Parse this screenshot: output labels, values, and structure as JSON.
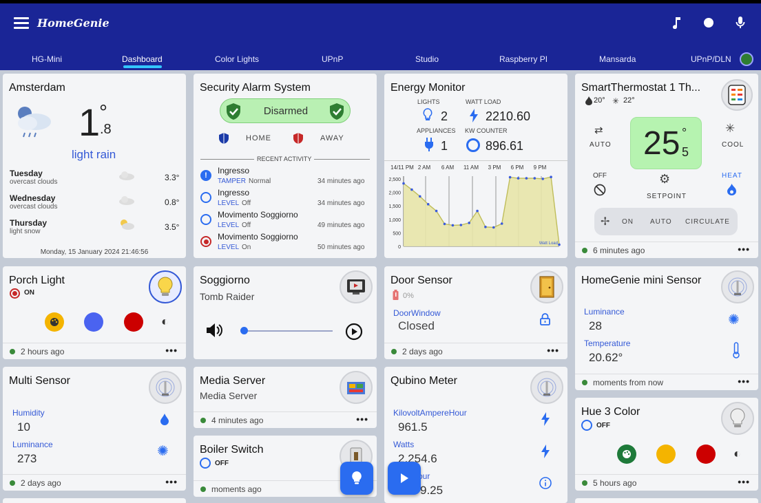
{
  "app": {
    "title": "HomeGenie"
  },
  "tabs": [
    "HG-Mini",
    "Dashboard",
    "Color Lights",
    "UPnP",
    "Studio",
    "Raspberry PI",
    "Mansarda",
    "UPnP/DLN"
  ],
  "weather": {
    "city": "Amsterdam",
    "temp_int": "1",
    "temp_dec": ".8",
    "degree": "°",
    "condition": "light rain",
    "forecast": [
      {
        "day": "Tuesday",
        "desc": "overcast clouds",
        "temp": "3.3°"
      },
      {
        "day": "Wednesday",
        "desc": "overcast clouds",
        "temp": "0.8°"
      },
      {
        "day": "Thursday",
        "desc": "light snow",
        "temp": "3.5°"
      }
    ],
    "datetime": "Monday, 15 January 2024 21:46:56"
  },
  "alarm": {
    "title": "Security Alarm System",
    "status": "Disarmed",
    "home": "HOME",
    "away": "AWAY",
    "recent_label": "RECENT ACTIVITY",
    "events": [
      {
        "name": "Ingresso",
        "prop": "TAMPER",
        "value": "Normal",
        "time": "34 minutes ago"
      },
      {
        "name": "Ingresso",
        "prop": "LEVEL",
        "value": "Off",
        "time": "34 minutes ago"
      },
      {
        "name": "Movimento Soggiorno",
        "prop": "LEVEL",
        "value": "Off",
        "time": "49 minutes ago"
      },
      {
        "name": "Movimento Soggiorno",
        "prop": "LEVEL",
        "value": "On",
        "time": "50 minutes ago"
      }
    ]
  },
  "energy": {
    "title": "Energy Monitor",
    "lights_label": "LIGHTS",
    "lights": "2",
    "watt_label": "WATT LOAD",
    "watt": "2210.60",
    "appliances_label": "APPLIANCES",
    "appliances": "1",
    "kw_label": "KW COUNTER",
    "kw": "896.61"
  },
  "chart_data": {
    "type": "area",
    "x_ticks": [
      "14/11 PM",
      "2 AM",
      "6 AM",
      "11 AM",
      "3 PM",
      "6 PM",
      "9 PM"
    ],
    "y_ticks": [
      "2,500",
      "2,000",
      "1,500",
      "1,000",
      "500",
      "0"
    ],
    "ylim": [
      0,
      2600
    ],
    "series": [
      {
        "name": "Watt Load",
        "values": [
          2330,
          2100,
          1850,
          1560,
          1310,
          830,
          780,
          790,
          870,
          1310,
          720,
          700,
          840,
          2560,
          2520,
          2520,
          2520,
          2500,
          2570,
          60
        ]
      }
    ],
    "fill_color": "#e8e6a8",
    "line_color": "#bfbd5a",
    "point_color": "#3b5bdb"
  },
  "thermostat": {
    "title": "SmartThermostat 1 Th...",
    "heat_temp": "20°",
    "cool_temp": "22°",
    "mode_auto": "AUTO",
    "mode_cool": "COOL",
    "mode_off": "OFF",
    "mode_heat": "HEAT",
    "setpoint": "25",
    "setpoint_dec": "5",
    "setpoint_label": "SETPOINT",
    "fan_on": "ON",
    "fan_auto": "AUTO",
    "fan_circulate": "CIRCULATE",
    "updated": "6 minutes ago"
  },
  "porch": {
    "title": "Porch Light",
    "status": "ON",
    "updated": "2 hours ago",
    "colors": [
      "#f4b400",
      "#4a63f0",
      "#cc0000"
    ]
  },
  "soggiorno": {
    "title": "Soggiorno",
    "subtitle": "Tomb Raider"
  },
  "door": {
    "title": "Door Sensor",
    "battery": "0%",
    "label": "DoorWindow",
    "value": "Closed",
    "updated": "2 days ago"
  },
  "hgmini": {
    "title": "HomeGenie mini Sensor",
    "lum_label": "Luminance",
    "lum": "28",
    "temp_label": "Temperature",
    "temp": "20.62°",
    "updated": "moments from now"
  },
  "multi": {
    "title": "Multi Sensor",
    "hum_label": "Humidity",
    "hum": "10",
    "lum_label": "Luminance",
    "lum": "273",
    "updated": "2 days ago"
  },
  "media": {
    "title": "Media Server",
    "subtitle": "Media Server",
    "updated": "4 minutes ago"
  },
  "boiler": {
    "title": "Boiler Switch",
    "status": "OFF",
    "updated": "moments ago"
  },
  "qubino": {
    "title": "Qubino Meter",
    "kvah_label": "KilovoltAmpereHour",
    "kvah": "961.5",
    "watts_label": "Watts",
    "watts": "2,254.6",
    "partial_label": "our",
    "partial": "9.25"
  },
  "hue": {
    "title": "Hue 3 Color",
    "status": "OFF",
    "updated": "5 hours ago",
    "colors": [
      "#1e7a3a",
      "#f4b400",
      "#cc0000"
    ]
  },
  "more": "•••"
}
